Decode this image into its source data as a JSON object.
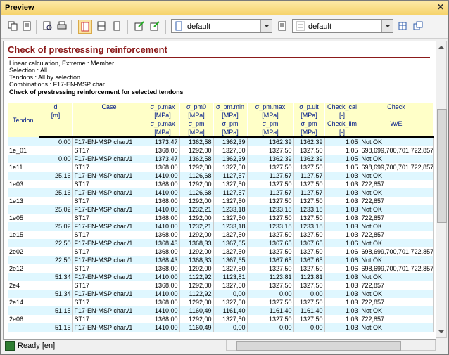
{
  "window": {
    "title": "Preview",
    "close": "✕"
  },
  "toolbar": {
    "combo1": {
      "value": "default"
    },
    "combo2": {
      "value": "default"
    }
  },
  "report": {
    "title": "Check of prestressing reinforcement",
    "lines": [
      "Linear calculation, Extreme : Member",
      "Selection : All",
      "Tendons : All by selection",
      "Combinations : F17-EN-MSP char."
    ],
    "subtitle": "Check of prestressing reinforcement for selected tendons",
    "headers": {
      "tendon": "Tendon",
      "d": "d",
      "d_unit": "[m]",
      "case": "Case",
      "s_pmax1": "σ_p.max",
      "s_pmax1_unit": "[MPa]",
      "s_pmax2": "σ_p.max",
      "s_pmax2_unit": "[MPa]",
      "s_pm0": "σ_pm0",
      "s_pm0_unit": "[MPa]",
      "s_pmmin": "σ_pm.min",
      "s_pmmin_unit": "[MPa]",
      "s_pm": "σ_pm",
      "s_pm_unit": "[MPa]",
      "s_pmmax": "σ_pm.max",
      "s_pmmax_unit": "[MPa]",
      "s_pm2": "σ_pm",
      "s_pm2_unit": "[MPa]",
      "s_pult": "σ_p.ult",
      "s_pult_unit": "[MPa]",
      "s_pm3": "σ_pm",
      "s_pm3_unit": "[MPa]",
      "check_cal": "Check_cal",
      "check_cal_unit": "[-]",
      "check_lim": "Check_lim",
      "check_lim_unit": "[-]",
      "check": "Check",
      "we": "W/E"
    },
    "rows": [
      {
        "tendon": "",
        "d": "0,00",
        "case": "F17-EN-MSP char./1",
        "c1": "1373,47",
        "c2": "1362,58",
        "c3": "1362,39",
        "c4": "1362,39",
        "c5": "1362,39",
        "c6": "1,05",
        "c7": "Not OK",
        "hl": true
      },
      {
        "tendon": "1e_01",
        "d": "",
        "case": "ST17",
        "c1": "1368,00",
        "c2": "1292,00",
        "c3": "1327,50",
        "c4": "1327,50",
        "c5": "1327,50",
        "c6": "1,05",
        "c7": "698,699,700,701,722,857",
        "hl": false
      },
      {
        "tendon": "",
        "d": "0,00",
        "case": "F17-EN-MSP char./1",
        "c1": "1373,47",
        "c2": "1362,58",
        "c3": "1362,39",
        "c4": "1362,39",
        "c5": "1362,39",
        "c6": "1,05",
        "c7": "Not OK",
        "hl": true
      },
      {
        "tendon": "1e11",
        "d": "",
        "case": "ST17",
        "c1": "1368,00",
        "c2": "1292,00",
        "c3": "1327,50",
        "c4": "1327,50",
        "c5": "1327,50",
        "c6": "1,05",
        "c7": "698,699,700,701,722,857",
        "hl": false
      },
      {
        "tendon": "",
        "d": "25,16",
        "case": "F17-EN-MSP char./1",
        "c1": "1410,00",
        "c2": "1126,68",
        "c3": "1127,57",
        "c4": "1127,57",
        "c5": "1127,57",
        "c6": "1,03",
        "c7": "Not OK",
        "hl": true
      },
      {
        "tendon": "1e03",
        "d": "",
        "case": "ST17",
        "c1": "1368,00",
        "c2": "1292,00",
        "c3": "1327,50",
        "c4": "1327,50",
        "c5": "1327,50",
        "c6": "1,03",
        "c7": "722,857",
        "hl": false
      },
      {
        "tendon": "",
        "d": "25,16",
        "case": "F17-EN-MSP char./1",
        "c1": "1410,00",
        "c2": "1126,68",
        "c3": "1127,57",
        "c4": "1127,57",
        "c5": "1127,57",
        "c6": "1,03",
        "c7": "Not OK",
        "hl": true
      },
      {
        "tendon": "1e13",
        "d": "",
        "case": "ST17",
        "c1": "1368,00",
        "c2": "1292,00",
        "c3": "1327,50",
        "c4": "1327,50",
        "c5": "1327,50",
        "c6": "1,03",
        "c7": "722,857",
        "hl": false
      },
      {
        "tendon": "",
        "d": "25,02",
        "case": "F17-EN-MSP char./1",
        "c1": "1410,00",
        "c2": "1232,21",
        "c3": "1233,18",
        "c4": "1233,18",
        "c5": "1233,18",
        "c6": "1,03",
        "c7": "Not OK",
        "hl": true
      },
      {
        "tendon": "1e05",
        "d": "",
        "case": "ST17",
        "c1": "1368,00",
        "c2": "1292,00",
        "c3": "1327,50",
        "c4": "1327,50",
        "c5": "1327,50",
        "c6": "1,03",
        "c7": "722,857",
        "hl": false
      },
      {
        "tendon": "",
        "d": "25,02",
        "case": "F17-EN-MSP char./1",
        "c1": "1410,00",
        "c2": "1232,21",
        "c3": "1233,18",
        "c4": "1233,18",
        "c5": "1233,18",
        "c6": "1,03",
        "c7": "Not OK",
        "hl": true
      },
      {
        "tendon": "1e15",
        "d": "",
        "case": "ST17",
        "c1": "1368,00",
        "c2": "1292,00",
        "c3": "1327,50",
        "c4": "1327,50",
        "c5": "1327,50",
        "c6": "1,03",
        "c7": "722,857",
        "hl": false
      },
      {
        "tendon": "",
        "d": "22,50",
        "case": "F17-EN-MSP char./1",
        "c1": "1368,43",
        "c2": "1368,33",
        "c3": "1367,65",
        "c4": "1367,65",
        "c5": "1367,65",
        "c6": "1,06",
        "c7": "Not OK",
        "hl": true
      },
      {
        "tendon": "2e02",
        "d": "",
        "case": "ST17",
        "c1": "1368,00",
        "c2": "1292,00",
        "c3": "1327,50",
        "c4": "1327,50",
        "c5": "1327,50",
        "c6": "1,06",
        "c7": "698,699,700,701,722,857",
        "hl": false
      },
      {
        "tendon": "",
        "d": "22,50",
        "case": "F17-EN-MSP char./1",
        "c1": "1368,43",
        "c2": "1368,33",
        "c3": "1367,65",
        "c4": "1367,65",
        "c5": "1367,65",
        "c6": "1,06",
        "c7": "Not OK",
        "hl": true
      },
      {
        "tendon": "2e12",
        "d": "",
        "case": "ST17",
        "c1": "1368,00",
        "c2": "1292,00",
        "c3": "1327,50",
        "c4": "1327,50",
        "c5": "1327,50",
        "c6": "1,06",
        "c7": "698,699,700,701,722,857",
        "hl": false
      },
      {
        "tendon": "",
        "d": "51,34",
        "case": "F17-EN-MSP char./1",
        "c1": "1410,00",
        "c2": "1122,92",
        "c3": "1123,81",
        "c4": "1123,81",
        "c5": "1123,81",
        "c6": "1,03",
        "c7": "Not OK",
        "hl": true
      },
      {
        "tendon": "2e4",
        "d": "",
        "case": "ST17",
        "c1": "1368,00",
        "c2": "1292,00",
        "c3": "1327,50",
        "c4": "1327,50",
        "c5": "1327,50",
        "c6": "1,03",
        "c7": "722,857",
        "hl": false
      },
      {
        "tendon": "",
        "d": "51,34",
        "case": "F17-EN-MSP char./1",
        "c1": "1410,00",
        "c2": "1122,92",
        "c3": "0,00",
        "c4": "0,00",
        "c5": "0,00",
        "c6": "1,03",
        "c7": "Not OK",
        "hl": true
      },
      {
        "tendon": "2e14",
        "d": "",
        "case": "ST17",
        "c1": "1368,00",
        "c2": "1292,00",
        "c3": "1327,50",
        "c4": "1327,50",
        "c5": "1327,50",
        "c6": "1,03",
        "c7": "722,857",
        "hl": false
      },
      {
        "tendon": "",
        "d": "51,15",
        "case": "F17-EN-MSP char./1",
        "c1": "1410,00",
        "c2": "1160,49",
        "c3": "1161,40",
        "c4": "1161,40",
        "c5": "1161,40",
        "c6": "1,03",
        "c7": "Not OK",
        "hl": true
      },
      {
        "tendon": "2e06",
        "d": "",
        "case": "ST17",
        "c1": "1368,00",
        "c2": "1292,00",
        "c3": "1327,50",
        "c4": "1327,50",
        "c5": "1327,50",
        "c6": "1,03",
        "c7": "722,857",
        "hl": false
      },
      {
        "tendon": "",
        "d": "51,15",
        "case": "F17-EN-MSP char./1",
        "c1": "1410,00",
        "c2": "1160,49",
        "c3": "0,00",
        "c4": "0,00",
        "c5": "0,00",
        "c6": "1,03",
        "c7": "Not OK",
        "hl": true
      }
    ]
  },
  "status": {
    "text": "Ready [en]"
  }
}
